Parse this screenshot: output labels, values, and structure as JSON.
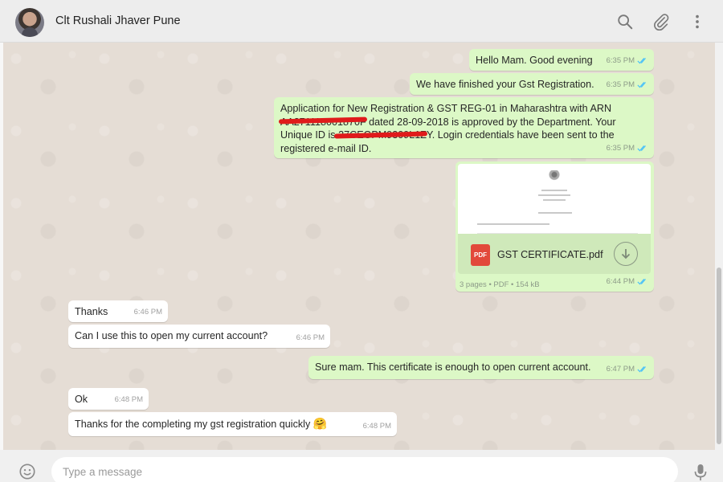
{
  "header": {
    "contact_name": "Clt Rushali Jhaver Pune",
    "icons": [
      "search-icon",
      "attach-icon",
      "menu-icon"
    ]
  },
  "messages": [
    {
      "dir": "out",
      "text": "Hello Mam. Good evening",
      "time": "6:35 PM",
      "ticks": "read"
    },
    {
      "dir": "out",
      "text": "We have finished your Gst Registration.",
      "time": "6:35 PM",
      "ticks": "read"
    },
    {
      "dir": "out",
      "lines": [
        "Application for New Registration & GST REG-01 in Maharashtra with ARN",
        "AA271118001870F dated 28-09-2018 is approved by the Department. Your",
        "Unique ID is 27CEGPM9309L1ZY. Login credentials have been sent to the",
        "registered e-mail ID."
      ],
      "time": "6:35 PM",
      "ticks": "read",
      "redacted": true
    },
    {
      "dir": "out",
      "type": "document",
      "doc_name": "GST CERTIFICATE.pdf",
      "doc_badge": "PDF",
      "doc_info": "3 pages • PDF • 154 kB",
      "time": "6:44 PM",
      "ticks": "read"
    },
    {
      "dir": "in",
      "text": "Thanks",
      "time": "6:46 PM"
    },
    {
      "dir": "in",
      "text": "Can I use this to open my current account?",
      "time": "6:46 PM"
    },
    {
      "dir": "out",
      "text": "Sure mam. This certificate is enough to open current account.",
      "time": "6:47 PM",
      "ticks": "read"
    },
    {
      "dir": "in",
      "text": "Ok",
      "time": "6:48 PM"
    },
    {
      "dir": "in",
      "text": "Thanks for the completing my gst registration quickly",
      "emoji": "🤗",
      "time": "6:48 PM"
    }
  ],
  "footer": {
    "placeholder": "Type a message",
    "icons": [
      "emoji-icon",
      "mic-icon"
    ]
  },
  "colors": {
    "outgoing_bubble": "#dcf8c6",
    "incoming_bubble": "#ffffff",
    "chat_bg": "#e5ddd5",
    "read_ticks": "#4fc3f7",
    "redaction": "#e01b1b",
    "pdf_badge": "#e2493b"
  }
}
